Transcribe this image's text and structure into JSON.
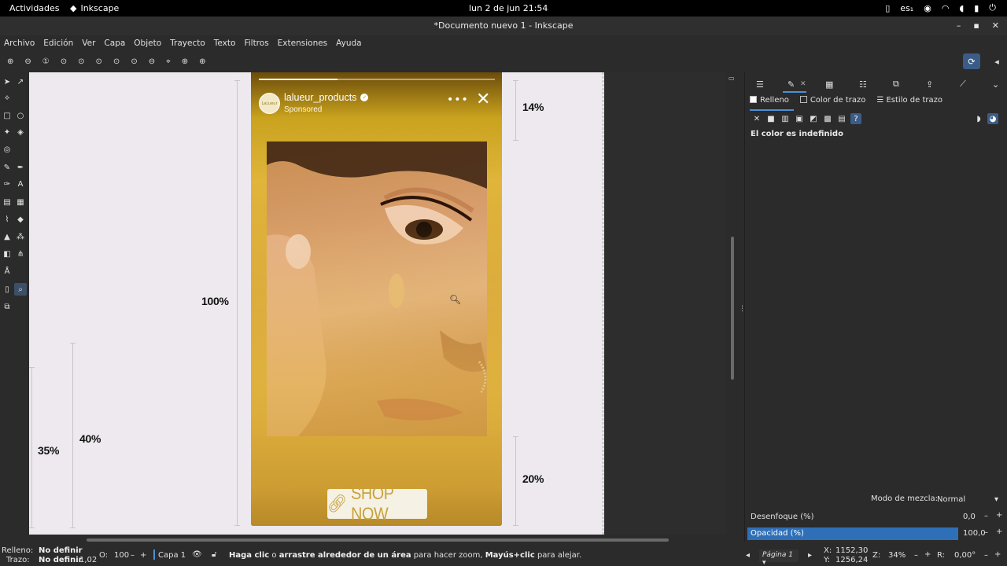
{
  "gnome": {
    "activities": "Actividades",
    "app_name": "Inkscape",
    "clock": "lun   2 de jun  21:54",
    "lang": "es",
    "lang_suffix": "₁"
  },
  "window": {
    "title": "*Documento nuevo 1 - Inkscape"
  },
  "menu": [
    "Archivo",
    "Edición",
    "Ver",
    "Capa",
    "Objeto",
    "Trayecto",
    "Texto",
    "Filtros",
    "Extensiones",
    "Ayuda"
  ],
  "canvas_labels": {
    "p100": "100%",
    "p40": "40%",
    "p35": "35%",
    "p14": "14%",
    "p20": "20%"
  },
  "story": {
    "username": "lalueur_products",
    "sponsored": "Sponsored",
    "avatar_text": "LaLueur",
    "cta": "SHOP NOW"
  },
  "fill_stroke": {
    "tab_fill": "Relleno",
    "tab_stroke_color": "Color de trazo",
    "tab_stroke_style": "Estilo de trazo",
    "undefined_msg": "El color es indefinido",
    "blend_label": "Modo de mezcla:",
    "blend_value": "Normal",
    "blur_label": "Desenfoque (%)",
    "blur_value": "0,0",
    "opacity_label": "Opacidad (%)",
    "opacity_value": "100,0",
    "opacity_level": 1.0
  },
  "status": {
    "fill_label": "Relleno:",
    "fill_value": "No definir",
    "stroke_label": "Trazo:",
    "stroke_value": "No definir",
    "stroke_width": "1,02",
    "opacity_label": "O:",
    "opacity_value": "100",
    "layer": "Capa 1",
    "msg_1": "Haga clic",
    "msg_2": " o ",
    "msg_3": "arrastre alrededor de un área",
    "msg_4": " para hacer zoom, ",
    "msg_5": "Mayús+clic",
    "msg_6": " para alejar.",
    "page": "Página 1",
    "x_label": "X:",
    "x_value": "1152,30",
    "y_label": "Y:",
    "y_value": "1256,24",
    "zoom_label": "Z:",
    "zoom_value": "34%",
    "rot_label": "R:",
    "rot_value": "0,00°"
  },
  "colors": {
    "accent": "#4a90d9",
    "opacity_bar": "#2f6fb8",
    "page": "#ede9ee",
    "story_gold": "#d9a83a"
  }
}
